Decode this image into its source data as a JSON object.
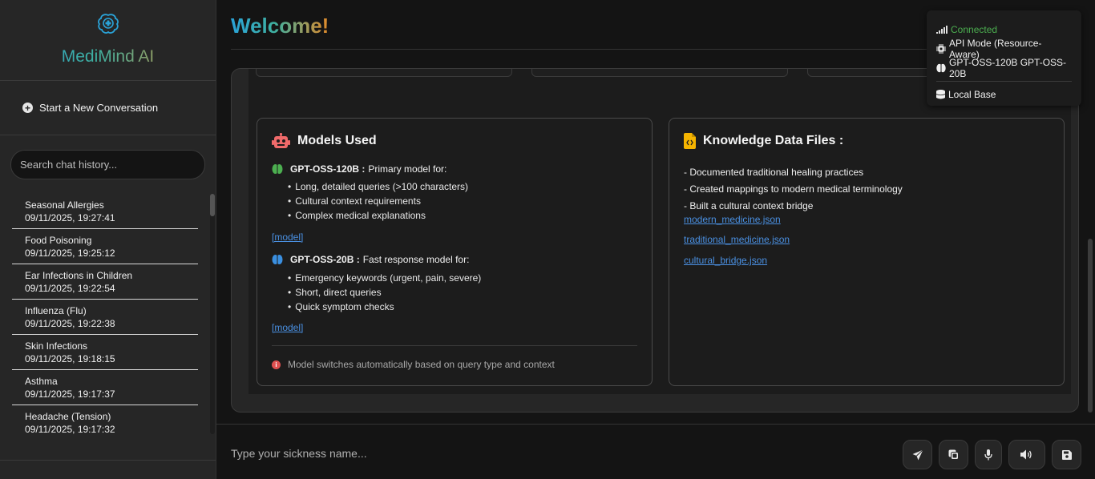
{
  "sidebar": {
    "brand": "MediMind AI",
    "new_conversation": "Start a New Conversation",
    "search_placeholder": "Search chat history...",
    "history": [
      {
        "title": "Seasonal Allergies",
        "date": "09/11/2025, 19:27:41"
      },
      {
        "title": "Food Poisoning",
        "date": "09/11/2025, 19:25:12"
      },
      {
        "title": "Ear Infections in Children",
        "date": "09/11/2025, 19:22:54"
      },
      {
        "title": "Influenza (Flu)",
        "date": "09/11/2025, 19:22:38"
      },
      {
        "title": "Skin Infections",
        "date": "09/11/2025, 19:18:15"
      },
      {
        "title": "Asthma",
        "date": "09/11/2025, 19:17:37"
      },
      {
        "title": "Headache (Tension)",
        "date": "09/11/2025, 19:17:32"
      }
    ]
  },
  "header": {
    "title": "Welcome!"
  },
  "models": {
    "title": "Models Used",
    "primary": {
      "name": "GPT-OSS-120B :",
      "desc": "Primary model for:",
      "bullets": [
        "Long, detailed queries (>100 characters)",
        "Cultural context requirements",
        "Complex medical explanations"
      ],
      "link": "[model]"
    },
    "fast": {
      "name": "GPT-OSS-20B :",
      "desc": "Fast response model for:",
      "bullets": [
        "Emergency keywords (urgent, pain, severe)",
        "Short, direct queries",
        "Quick symptom checks"
      ],
      "link": "[model]"
    },
    "note": "Model switches automatically based on query type and context"
  },
  "files": {
    "title": "Knowledge Data Files :",
    "lines": [
      "- Documented traditional healing practices",
      "- Created mappings to modern medical terminology",
      "- Built a cultural context bridge"
    ],
    "links": [
      "modern_medicine.json",
      "traditional_medicine.json",
      "cultural_bridge.json"
    ]
  },
  "status": {
    "connection": "Connected",
    "mode": "API Mode (Resource-Aware)",
    "models": "GPT-OSS-120B GPT-OSS-20B",
    "base": "Local Base"
  },
  "input": {
    "placeholder": "Type your sickness name..."
  },
  "colors": {
    "accent_blue": "#2aa3d8",
    "accent_orange": "#e28b2a",
    "connected_green": "#4caf50",
    "link_blue": "#4a90e2"
  }
}
